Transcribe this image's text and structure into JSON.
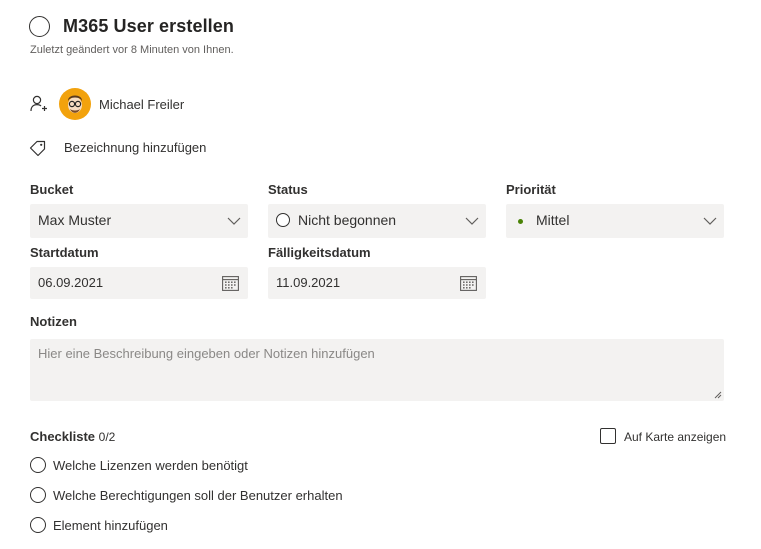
{
  "task": {
    "title": "M365 User erstellen",
    "modified": "Zuletzt geändert vor 8 Minuten von Ihnen."
  },
  "assignee": {
    "name": "Michael Freiler"
  },
  "label_action": "Bezeichnung hinzufügen",
  "fields": {
    "bucket": {
      "label": "Bucket",
      "value": "Max Muster"
    },
    "status": {
      "label": "Status",
      "value": "Nicht begonnen"
    },
    "priority": {
      "label": "Priorität",
      "value": "Mittel",
      "dot_color": "#498205"
    },
    "start": {
      "label": "Startdatum",
      "value": "06.09.2021"
    },
    "due": {
      "label": "Fälligkeitsdatum",
      "value": "11.09.2021"
    }
  },
  "notes": {
    "label": "Notizen",
    "placeholder": "Hier eine Beschreibung eingeben oder Notizen hinzufügen"
  },
  "checklist": {
    "label": "Checkliste",
    "count": "0/2",
    "show_on_card": "Auf Karte anzeigen",
    "items": [
      "Welche Lizenzen werden benötigt",
      "Welche Berechtigungen soll der Benutzer erhalten"
    ],
    "add_item": "Element hinzufügen"
  },
  "colors": {
    "avatar_bg": "#f2a20d",
    "field_bg": "#f3f2f1"
  }
}
